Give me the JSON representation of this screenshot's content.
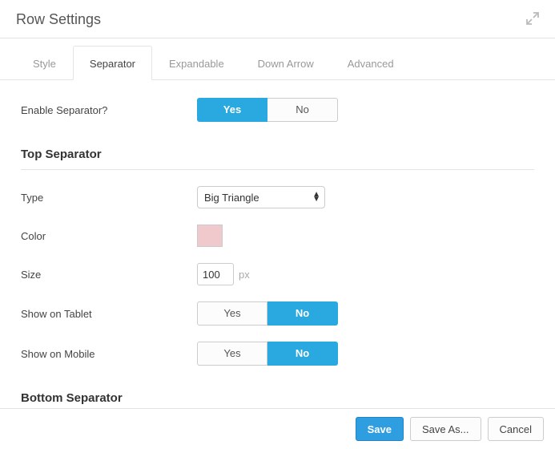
{
  "header": {
    "title": "Row Settings"
  },
  "tabs": [
    "Style",
    "Separator",
    "Expandable",
    "Down Arrow",
    "Advanced"
  ],
  "active_tab": 1,
  "fields": {
    "enable_label": "Enable Separator?",
    "enable_yes": "Yes",
    "enable_no": "No",
    "type_label": "Type",
    "type_value": "Big Triangle",
    "color_label": "Color",
    "color_value": "#efc9cb",
    "size_label": "Size",
    "size_value": "100",
    "size_unit": "px",
    "tablet_label": "Show on Tablet",
    "tablet_yes": "Yes",
    "tablet_no": "No",
    "mobile_label": "Show on Mobile",
    "mobile_yes": "Yes",
    "mobile_no": "No"
  },
  "sections": {
    "top": "Top Separator",
    "bottom": "Bottom Separator"
  },
  "footer": {
    "save": "Save",
    "save_as": "Save As...",
    "cancel": "Cancel"
  }
}
